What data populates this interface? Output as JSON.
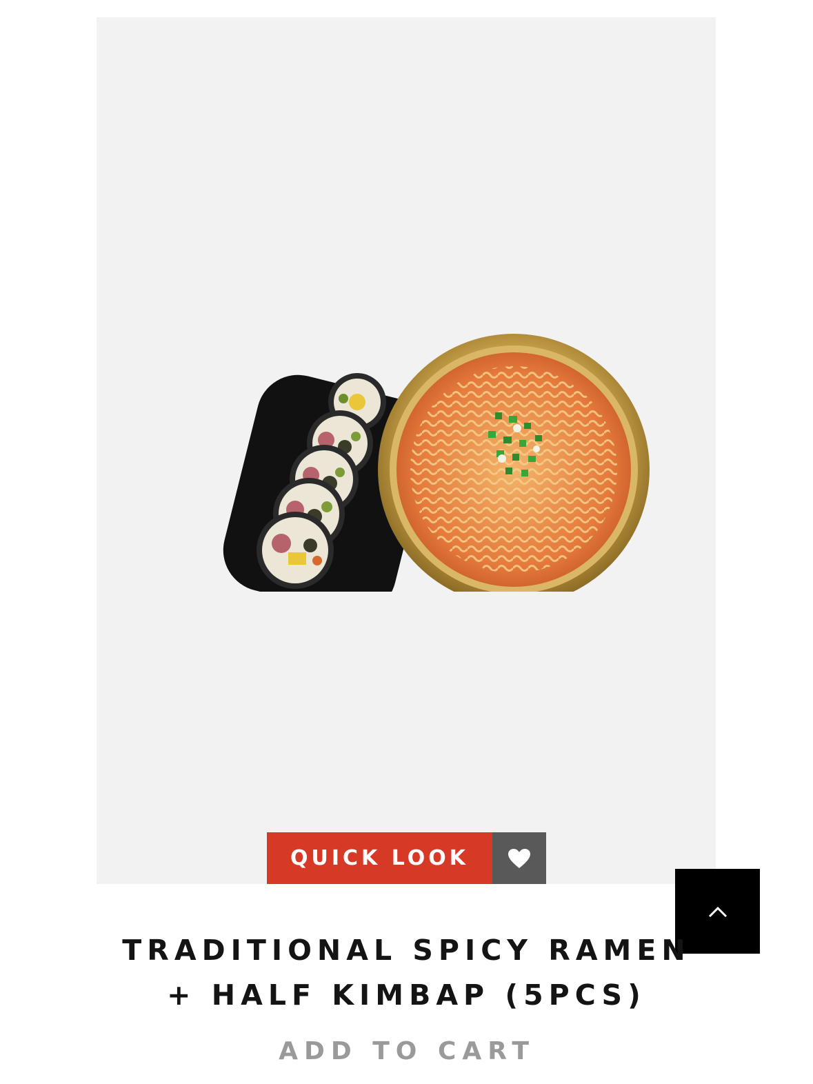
{
  "product": {
    "image_alt": "Traditional spicy ramen with half kimbap",
    "title_line1": "TRADITIONAL SPICY RAMEN",
    "title_line2": "+ HALF KIMBAP (5PCS)"
  },
  "actions": {
    "quick_look_label": "QUICK LOOK",
    "add_to_cart_label": "ADD TO CART",
    "wishlist_icon": "heart-icon",
    "back_to_top_icon": "chevron-up-icon"
  },
  "colors": {
    "quick_look_bg": "#d63a27",
    "wishlist_bg": "#595959",
    "back_to_top_bg": "#000000",
    "image_panel_bg": "#f2f2f2",
    "add_to_cart_text": "#9a9a9a"
  }
}
